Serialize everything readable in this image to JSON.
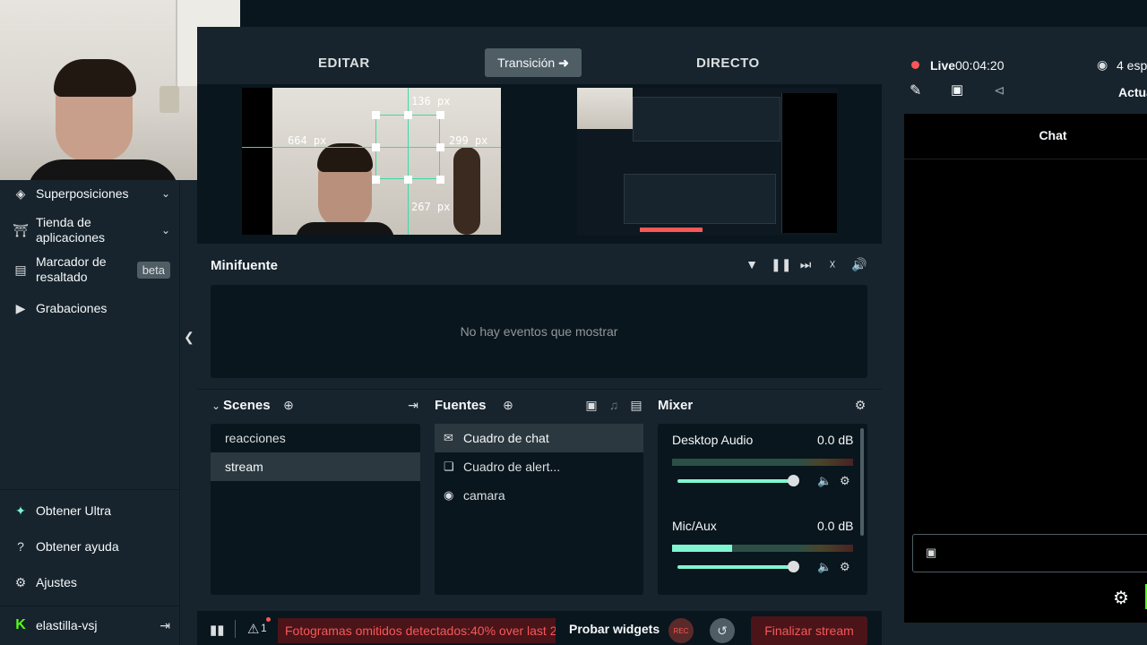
{
  "studio": {
    "edit_label": "EDITAR",
    "live_label": "DIRECTO",
    "transition_label": "Transición"
  },
  "overlay_measures": {
    "top": "136 px",
    "left": "664 px",
    "right": "299 px",
    "bottom": "267 px"
  },
  "sidebar": {
    "items": [
      {
        "label": "Superposiciones",
        "icon": "layers-icon"
      },
      {
        "label": "Tienda de aplicaciones",
        "icon": "store-icon"
      },
      {
        "label": "Marcador de resaltado",
        "icon": "highlighter-icon",
        "badge": "beta"
      },
      {
        "label": "Grabaciones",
        "icon": "play-circle-icon"
      }
    ],
    "bottom": [
      {
        "label": "Obtener Ultra",
        "icon": "ultra-icon"
      },
      {
        "label": "Obtener ayuda",
        "icon": "help-icon"
      },
      {
        "label": "Ajustes",
        "icon": "gear-icon"
      }
    ],
    "user": "elastilla-vsj"
  },
  "minifeed": {
    "title": "Minifuente",
    "empty": "No hay eventos que mostrar"
  },
  "scenes": {
    "title": "Scenes",
    "items": [
      "reacciones",
      "stream"
    ],
    "selected": "stream"
  },
  "sources": {
    "title": "Fuentes",
    "items": [
      {
        "label": "Cuadro de chat",
        "icon": "chat-icon"
      },
      {
        "label": "Cuadro de alert...",
        "icon": "alert-box-icon"
      },
      {
        "label": "camara",
        "icon": "webcam-icon"
      }
    ],
    "selected": "Cuadro de chat"
  },
  "mixer": {
    "title": "Mixer",
    "channels": [
      {
        "name": "Desktop Audio",
        "db": "0.0 dB",
        "level": 0,
        "volume": 1.0
      },
      {
        "name": "Mic/Aux",
        "db": "0.0 dB",
        "level": 0.33,
        "volume": 1.0
      }
    ]
  },
  "footer": {
    "warning_count": "1",
    "warning": "Fotogramas omitidos detectados:40% over last 2",
    "test_widgets": "Probar widgets",
    "rec": "REC",
    "end_stream": "Finalizar stream"
  },
  "live": {
    "status": "Live",
    "time": "00:04:20",
    "viewers": "4 esp",
    "update_label": "Actua",
    "chat_title": "Chat"
  },
  "colors": {
    "accent": "#80f5d2",
    "danger": "#f85757",
    "bg_dark": "#09161d",
    "bg_panel": "#17242d"
  }
}
